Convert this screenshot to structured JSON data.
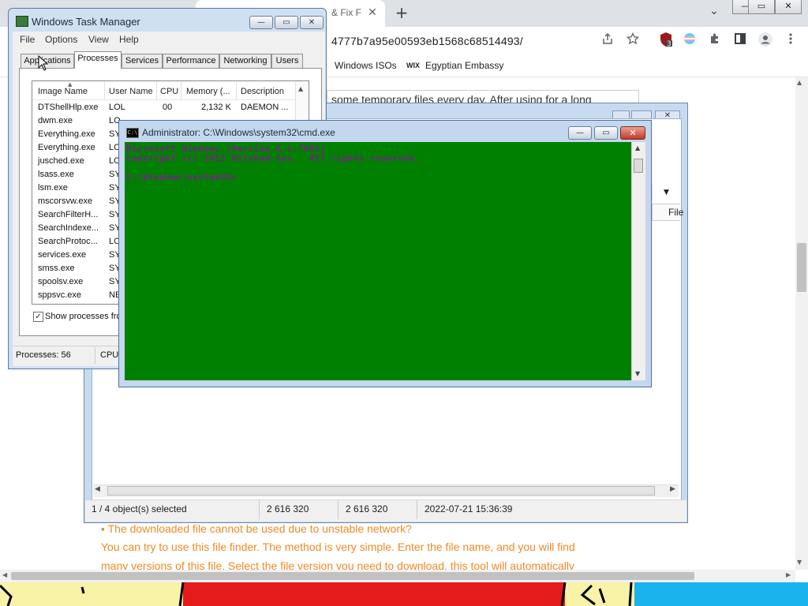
{
  "browser": {
    "tab_title": "& Fix F",
    "tab_close": "✕",
    "new_tab": "+",
    "tab_search": "⌄",
    "window_controls": [
      "—",
      "▭",
      "✕"
    ],
    "url": "4777b7a95e00593eb1568c68514493/",
    "toolbar_icons": [
      "share-icon",
      "star-icon",
      "ublock-icon",
      "extension-flag-icon",
      "puzzle-icon",
      "sidebar-icon",
      "profile-icon",
      "menu-icon"
    ],
    "extension_badge": "3",
    "bookmarks": [
      {
        "label": "Windows ISOs"
      },
      {
        "label": "Egyptian Embassy",
        "prefix": "WIX"
      }
    ],
    "page": {
      "top_text": "some temporary files every day. After using for a long",
      "lines": [
        "▪ The downloaded file cannot be used due to unstable network?",
        "You can try to use this file finder. The method is very simple. Enter the file name, and you will find",
        "many versions of this file. Select the file version you need to download, this tool will automatically"
      ]
    }
  },
  "explorer": {
    "file_label": "File",
    "status": {
      "selected": "1 / 4 object(s) selected",
      "size1": "2 616 320",
      "size2": "2 616 320",
      "date": "2022-07-21 15:36:39"
    }
  },
  "taskmgr": {
    "title": "Windows Task Manager",
    "menu": [
      "File",
      "Options",
      "View",
      "Help"
    ],
    "tabs": [
      "Applications",
      "Processes",
      "Services",
      "Performance",
      "Networking",
      "Users"
    ],
    "active_tab": "Processes",
    "columns": [
      "Image Name",
      "User Name",
      "CPU",
      "Memory (...",
      "Description"
    ],
    "rows": [
      {
        "image": "DTShellHlp.exe",
        "user": "LOL",
        "cpu": "00",
        "mem": "2,132 K",
        "desc": "DAEMON ..."
      },
      {
        "image": "dwm.exe",
        "user": "LO"
      },
      {
        "image": "Everything.exe",
        "user": "SY"
      },
      {
        "image": "Everything.exe",
        "user": "LO"
      },
      {
        "image": "jusched.exe",
        "user": "LO"
      },
      {
        "image": "lsass.exe",
        "user": "SY"
      },
      {
        "image": "lsm.exe",
        "user": "SY"
      },
      {
        "image": "mscorsvw.exe",
        "user": "SY"
      },
      {
        "image": "SearchFilterH...",
        "user": "SY"
      },
      {
        "image": "SearchIndexe...",
        "user": "SY"
      },
      {
        "image": "SearchProtoc...",
        "user": "LO"
      },
      {
        "image": "services.exe",
        "user": "SY"
      },
      {
        "image": "smss.exe",
        "user": "SY"
      },
      {
        "image": "spoolsv.exe",
        "user": "SY"
      },
      {
        "image": "sppsvc.exe",
        "user": "NE"
      }
    ],
    "show_processes_label": "Show processes fro",
    "show_processes_checked": true,
    "status": {
      "processes": "Processes: 56",
      "cpu": "CPU"
    }
  },
  "cmd": {
    "title": "Administrator: C:\\Windows\\system32\\cmd.exe",
    "lines": [
      "Microsoft Windows [Version 6.1.7601]",
      "Copyright (c) 2013 Ditshad Sys.  All rights reserved.",
      "",
      "C:\\Windows\\system32>"
    ],
    "colors": {
      "background": "#008000",
      "text": "#7a1f8a"
    }
  }
}
